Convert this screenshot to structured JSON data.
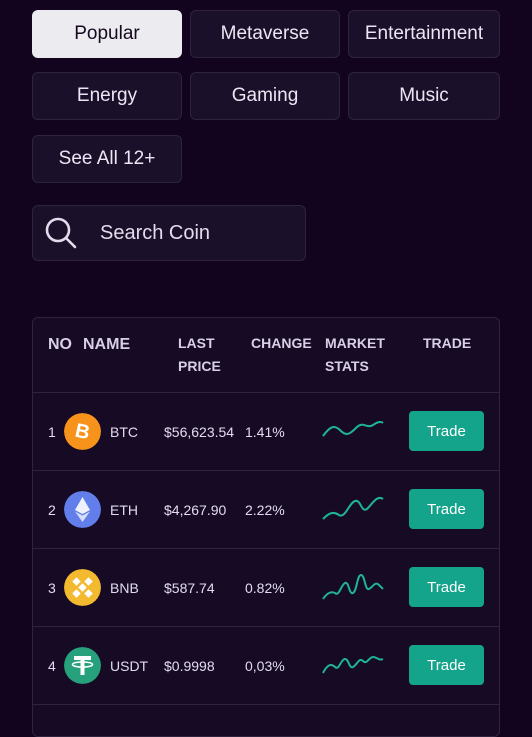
{
  "categories": [
    "Popular",
    "Metaverse",
    "Entertainment",
    "Energy",
    "Gaming",
    "Music",
    "See All 12+"
  ],
  "search": {
    "placeholder": "Search Coin"
  },
  "table": {
    "headers": {
      "no": "NO",
      "name": "NAME",
      "last": "LAST",
      "price": "PRICE",
      "change": "CHANGE",
      "market": "MARKET",
      "stats": "STATS",
      "trade": "TRADE"
    },
    "rows": [
      {
        "no": "1",
        "symbol": "BTC",
        "price": "$56,623.54",
        "change": "1.41%",
        "icon": "bitcoin-icon",
        "color": "#f7931a",
        "trade": "Trade"
      },
      {
        "no": "2",
        "symbol": "ETH",
        "price": "$4,267.90",
        "change": "2.22%",
        "icon": "ethereum-icon",
        "color": "#627eea",
        "trade": "Trade"
      },
      {
        "no": "3",
        "symbol": "BNB",
        "price": "$587.74",
        "change": "0.82%",
        "icon": "binance-icon",
        "color": "#f3ba2f",
        "trade": "Trade"
      },
      {
        "no": "4",
        "symbol": "USDT",
        "price": "$0.9998",
        "change": "0,03%",
        "icon": "tether-icon",
        "color": "#26a17b",
        "trade": "Trade"
      }
    ]
  },
  "colors": {
    "accent": "#14a48c",
    "background": "#12041f"
  }
}
